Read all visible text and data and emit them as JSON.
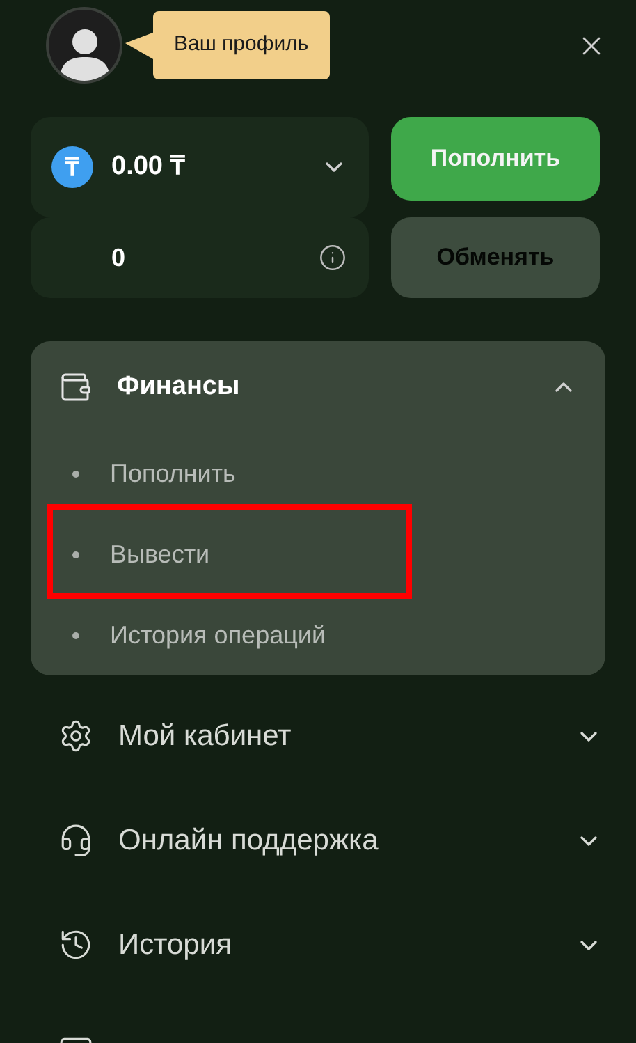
{
  "profile": {
    "tooltip": "Ваш профиль"
  },
  "balance": {
    "amount": "0.00 ₸",
    "currency_symbol": "₸",
    "bonus": "0"
  },
  "buttons": [
    {
      "label": "Пополнить",
      "disabled": false
    },
    {
      "label": "Обменять",
      "disabled": true
    }
  ],
  "finance": {
    "title": "Финансы",
    "expanded": true,
    "items": [
      {
        "label": "Пополнить",
        "highlighted": false
      },
      {
        "label": "Вывести",
        "highlighted": true
      },
      {
        "label": "История операций",
        "highlighted": false
      }
    ]
  },
  "menu": [
    {
      "kind": "gear",
      "label": "Мой кабинет",
      "expanded": false
    },
    {
      "kind": "headset",
      "label": "Онлайн поддержка",
      "expanded": false
    },
    {
      "kind": "clock",
      "label": "История",
      "expanded": false
    },
    {
      "kind": "card"
    }
  ]
}
